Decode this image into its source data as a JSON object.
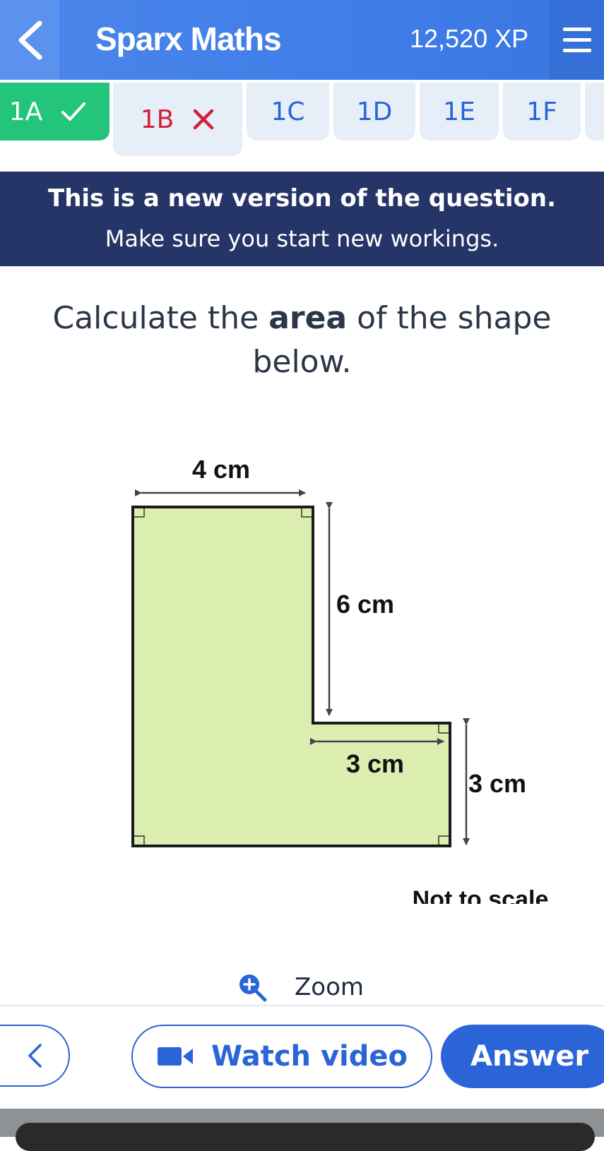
{
  "header": {
    "title": "Sparx Maths",
    "xp": "12,520 XP"
  },
  "tabs": [
    {
      "label": "1A",
      "status": "correct"
    },
    {
      "label": "1B",
      "status": "incorrect"
    },
    {
      "label": "1C"
    },
    {
      "label": "1D"
    },
    {
      "label": "1E"
    },
    {
      "label": "1F"
    }
  ],
  "banner": {
    "line1": "This is a new version of the question.",
    "line2": "Make sure you start new workings."
  },
  "question": {
    "before": "Calculate the ",
    "bold": "area",
    "after": " of the shape below."
  },
  "diagram": {
    "dims": {
      "top_width": "4 cm",
      "upper_height": "6 cm",
      "step_width": "3 cm",
      "step_height": "3 cm"
    },
    "note": "Not to scale",
    "fill_color": "#dcedb0"
  },
  "zoom_label": "Zoom",
  "bottom": {
    "video_label": "Watch video",
    "answer_label": "Answer"
  },
  "colors": {
    "header_blue": "#3f7de8",
    "tab_correct": "#22c57a",
    "tab_incorrect_text": "#d21f3c",
    "banner_navy": "#263567",
    "accent_blue": "#2a64d6"
  }
}
